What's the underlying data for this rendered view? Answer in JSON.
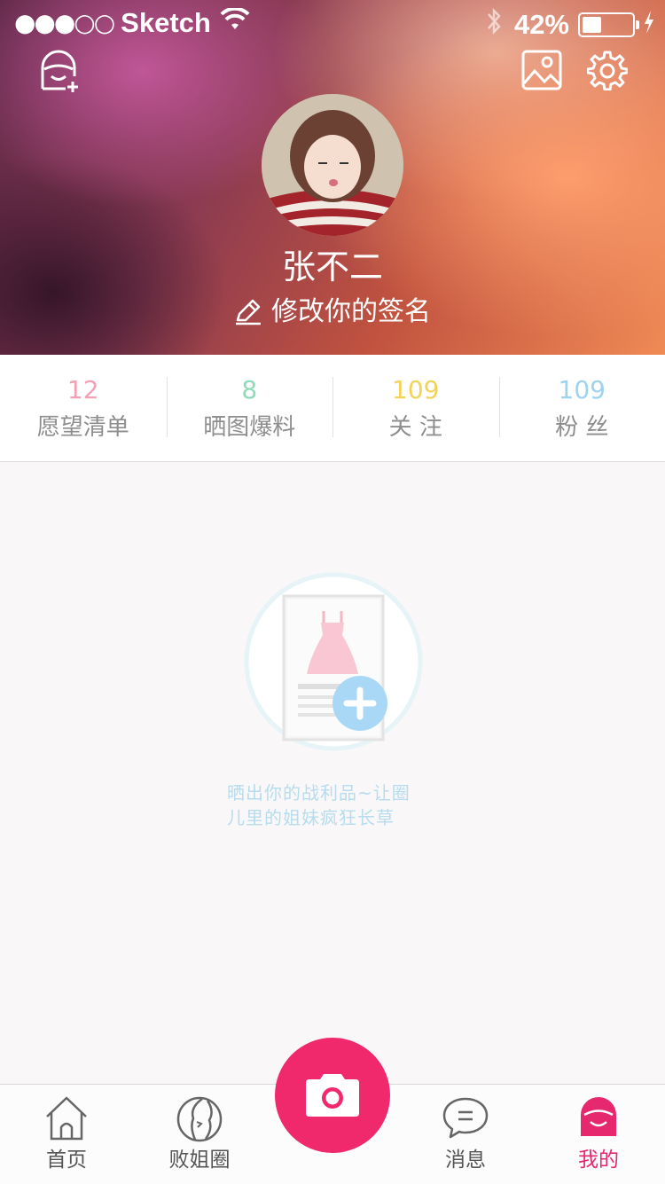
{
  "status_bar": {
    "signal": "●●●○○",
    "carrier": "Sketch",
    "battery_percent": "42%",
    "battery_level": 0.42
  },
  "header": {
    "username": "张不二",
    "signature": "修改你的签名"
  },
  "stats": [
    {
      "count": "12",
      "label": "愿望清单",
      "color": "#f4a0b4"
    },
    {
      "count": "8",
      "label": "晒图爆料",
      "color": "#8fdab8"
    },
    {
      "count": "109",
      "label": "关 注",
      "color": "#f2d35a"
    },
    {
      "count": "109",
      "label": "粉 丝",
      "color": "#9ed3ef"
    }
  ],
  "empty_state": {
    "line1": "晒出你的战利品~让圈",
    "line2": "儿里的姐妹疯狂长草"
  },
  "tabbar": {
    "tabs": [
      {
        "label": "首页",
        "icon": "home-icon"
      },
      {
        "label": "败姐圈",
        "icon": "girl-profile-icon"
      },
      {
        "label": "消息",
        "icon": "chat-bubble-icon"
      },
      {
        "label": "我的",
        "icon": "me-icon"
      }
    ],
    "active_index": 3,
    "active_color": "#e6286e",
    "camera_color": "#f0286c"
  }
}
